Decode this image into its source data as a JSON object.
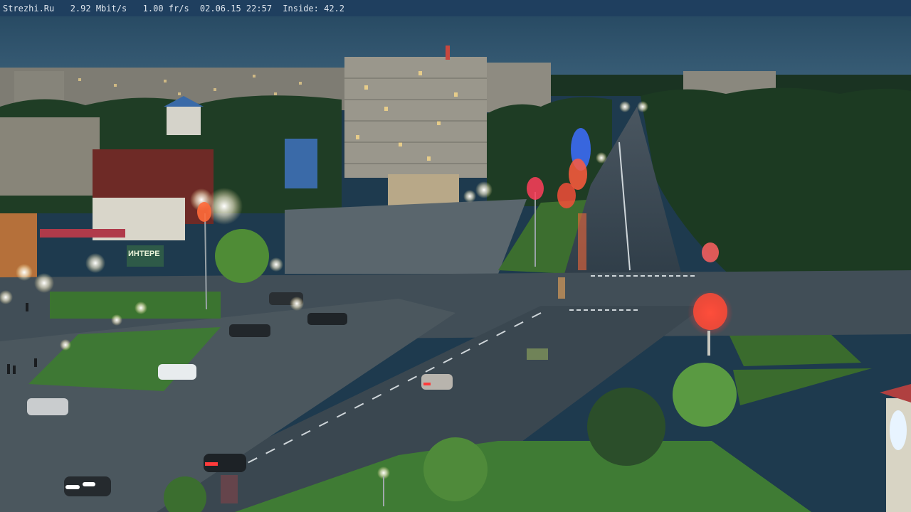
{
  "overlay": {
    "site": "Strezhi.Ru",
    "bitrate": "2.92 Mbit/s",
    "framerate": "1.00 fr/s",
    "datetime": "02.06.15 22:57",
    "inside_label": "Inside: 42.2"
  },
  "scene": {
    "storefront_sign": "ИНТЕРЕ"
  },
  "colors": {
    "sky": "#2b4c66",
    "overlay_bar": "#1f3f5f",
    "road": "#3a4a55",
    "grass": "#3f7a32",
    "trees": "#1d3a22",
    "buildings": "#8c8a80"
  }
}
